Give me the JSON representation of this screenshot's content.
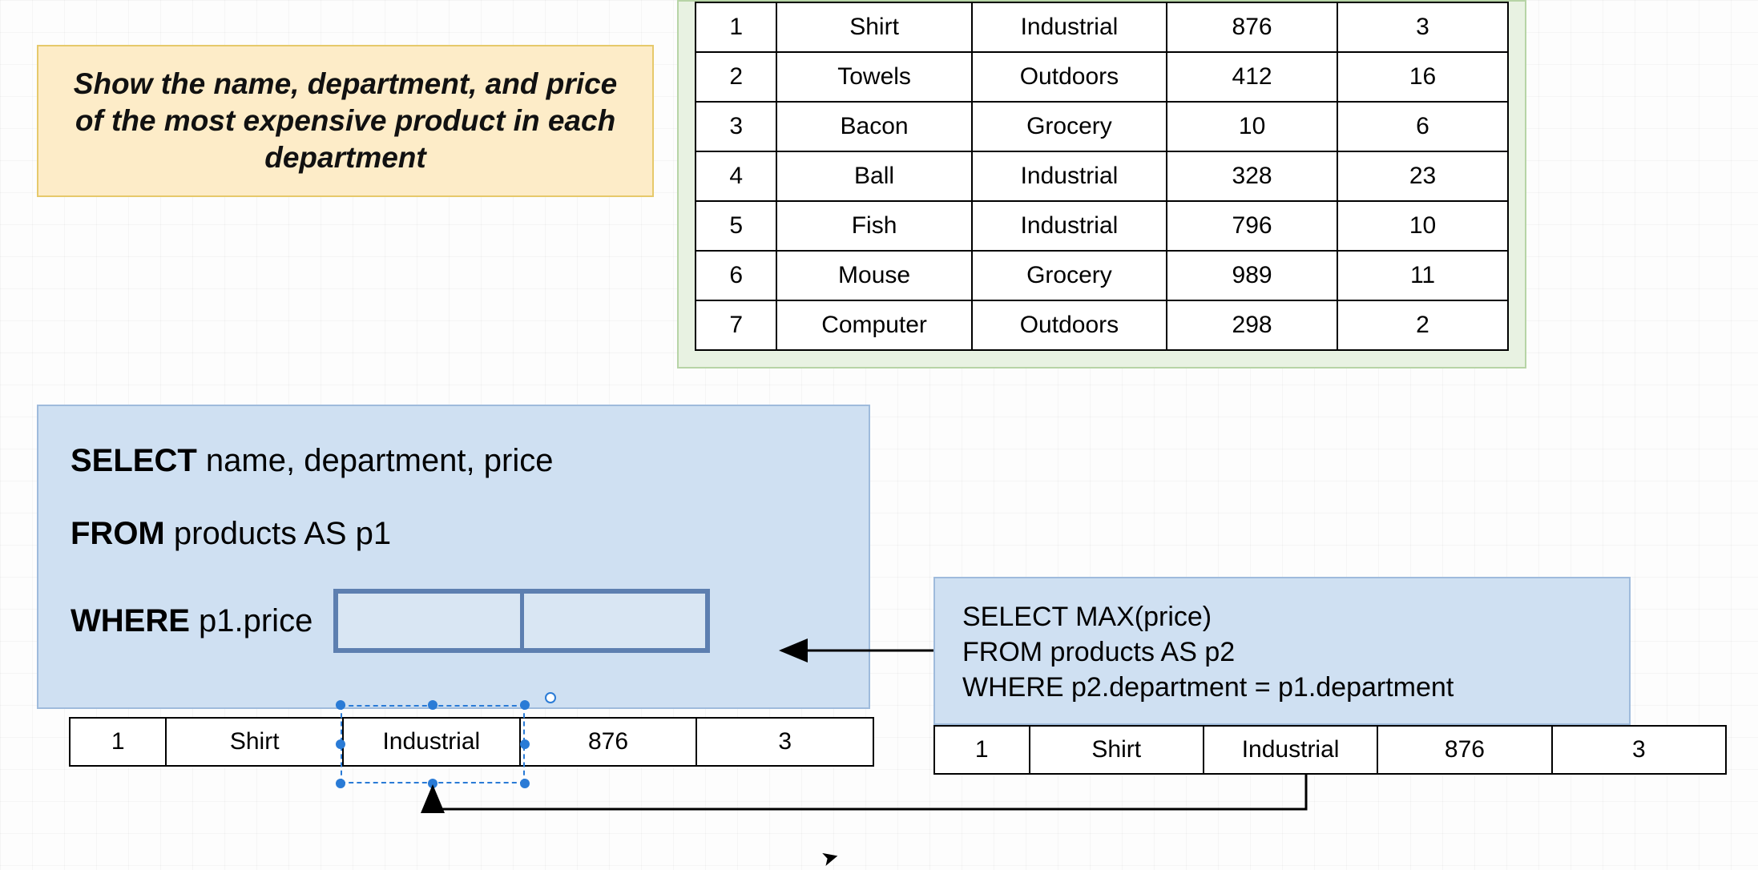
{
  "question": "Show the name, department, and price of the most expensive product in each department",
  "products": [
    {
      "id": "1",
      "name": "Shirt",
      "department": "Industrial",
      "colA": "876",
      "colB": "3"
    },
    {
      "id": "2",
      "name": "Towels",
      "department": "Outdoors",
      "colA": "412",
      "colB": "16"
    },
    {
      "id": "3",
      "name": "Bacon",
      "department": "Grocery",
      "colA": "10",
      "colB": "6"
    },
    {
      "id": "4",
      "name": "Ball",
      "department": "Industrial",
      "colA": "328",
      "colB": "23"
    },
    {
      "id": "5",
      "name": "Fish",
      "department": "Industrial",
      "colA": "796",
      "colB": "10"
    },
    {
      "id": "6",
      "name": "Mouse",
      "department": "Grocery",
      "colA": "989",
      "colB": "11"
    },
    {
      "id": "7",
      "name": "Computer",
      "department": "Outdoors",
      "colA": "298",
      "colB": "2"
    }
  ],
  "outer_query": {
    "select_kw": "SELECT",
    "select_cols": " name, department, price",
    "from_kw": "FROM",
    "from_body": " products AS p1",
    "where_kw": "WHERE",
    "where_body": " p1.price"
  },
  "inner_query": {
    "line1": "SELECT MAX(price)",
    "line2": "FROM products AS p2",
    "line3": "WHERE p2.department = p1.department"
  },
  "row_left": {
    "c1": "1",
    "c2": "Shirt",
    "c3": "Industrial",
    "c4": "876",
    "c5": "3"
  },
  "row_right": {
    "c1": "1",
    "c2": "Shirt",
    "c3": "Industrial",
    "c4": "876",
    "c5": "3"
  }
}
